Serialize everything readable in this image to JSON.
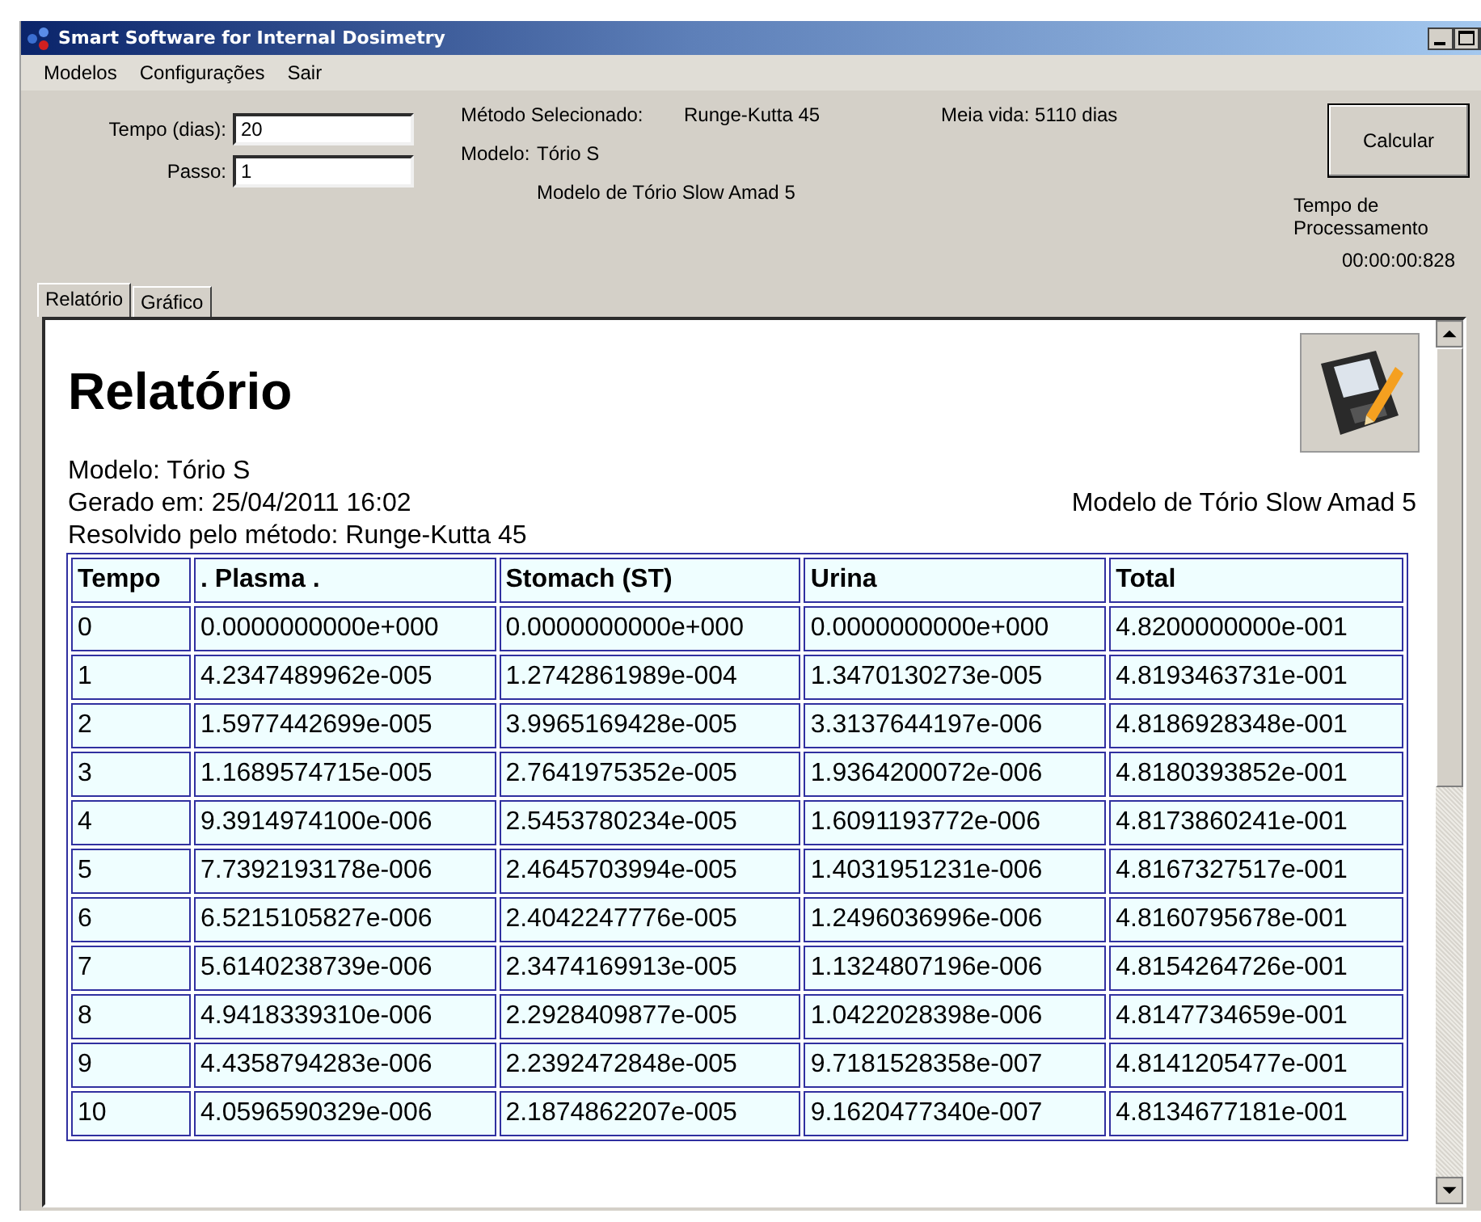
{
  "window": {
    "title": "Smart Software for Internal Dosimetry"
  },
  "menu": [
    "Modelos",
    "Configurações",
    "Sair"
  ],
  "form": {
    "fields": [
      {
        "label": "Tempo (dias):",
        "value": "20"
      },
      {
        "label": "Passo:",
        "value": "1"
      }
    ],
    "method_label": "Método Selecionado:",
    "method": "Runge-Kutta 45",
    "model_label": "Modelo:",
    "model": "Tório S",
    "model_desc": "Modelo de Tório Slow Amad 5",
    "half_life": "Meia vida: 5110 dias",
    "button": "Calcular",
    "processing_label": "Tempo de Processamento",
    "processing_time": "00:00:00:828"
  },
  "tabs": [
    {
      "label": "Relatório",
      "selected": true
    },
    {
      "label": "Gráfico",
      "selected": false
    }
  ],
  "report": {
    "title": "Relatório",
    "model": "Modelo: Tório S",
    "generated": "Gerado em: 25/04/2011 16:02",
    "model_desc": "Modelo de Tório Slow Amad 5",
    "method": "Resolvido pelo método: Runge-Kutta 45",
    "table": {
      "columns": [
        "Tempo",
        ". Plasma .",
        "Stomach (ST)",
        "Urina",
        "Total"
      ],
      "rows": [
        [
          "0",
          "0.0000000000e+000",
          "0.0000000000e+000",
          "0.0000000000e+000",
          "4.8200000000e-001"
        ],
        [
          "1",
          "4.2347489962e-005",
          "1.2742861989e-004",
          "1.3470130273e-005",
          "4.8193463731e-001"
        ],
        [
          "2",
          "1.5977442699e-005",
          "3.9965169428e-005",
          "3.3137644197e-006",
          "4.8186928348e-001"
        ],
        [
          "3",
          "1.1689574715e-005",
          "2.7641975352e-005",
          "1.9364200072e-006",
          "4.8180393852e-001"
        ],
        [
          "4",
          "9.3914974100e-006",
          "2.5453780234e-005",
          "1.6091193772e-006",
          "4.8173860241e-001"
        ],
        [
          "5",
          "7.7392193178e-006",
          "2.4645703994e-005",
          "1.4031951231e-006",
          "4.8167327517e-001"
        ],
        [
          "6",
          "6.5215105827e-006",
          "2.4042247776e-005",
          "1.2496036996e-006",
          "4.8160795678e-001"
        ],
        [
          "7",
          "5.6140238739e-006",
          "2.3474169913e-005",
          "1.1324807196e-006",
          "4.8154264726e-001"
        ],
        [
          "8",
          "4.9418339310e-006",
          "2.2928409877e-005",
          "1.0422028398e-006",
          "4.8147734659e-001"
        ],
        [
          "9",
          "4.4358794283e-006",
          "2.2392472848e-005",
          "9.7181528358e-007",
          "4.8141205477e-001"
        ],
        [
          "10",
          "4.0596590329e-006",
          "2.1874862207e-005",
          "9.1620477340e-007",
          "4.8134677181e-001"
        ]
      ]
    }
  }
}
